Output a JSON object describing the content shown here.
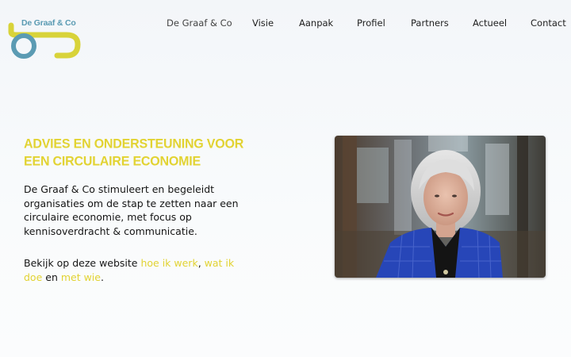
{
  "logo": {
    "text": "De Graaf & Co",
    "colors": {
      "blue": "#5b9bb3",
      "yellow": "#d8d33a"
    }
  },
  "nav": {
    "items": [
      {
        "label": "De Graaf & Co"
      },
      {
        "label": "Visie"
      },
      {
        "label": "Aanpak"
      },
      {
        "label": "Profiel"
      },
      {
        "label": "Partners"
      },
      {
        "label": "Actueel"
      },
      {
        "label": "Contact"
      }
    ]
  },
  "hero": {
    "headline": "ADVIES EN ONDERSTEUNING VOOR EEN CIRCULAIRE ECONOMIE",
    "intro": "De Graaf & Co stimuleert en begeleidt organisaties om de stap te zetten naar een circulaire economie, met focus op kennisoverdracht & communicatie.",
    "cta": {
      "prefix": "Bekijk op deze website ",
      "link1": "hoe ik werk",
      "sep1": ", ",
      "link2": "wat ik doe",
      "sep2": " en ",
      "link3": "met wie",
      "suffix": "."
    },
    "photo_icon": "portrait-photo"
  },
  "colors": {
    "accent": "#e2d332",
    "text": "#151515"
  }
}
